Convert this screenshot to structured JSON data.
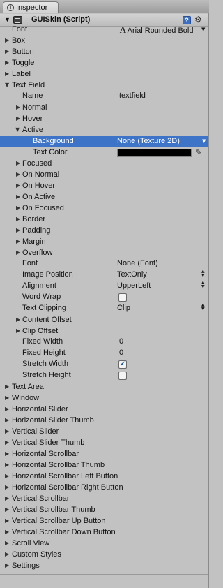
{
  "tab": {
    "label": "Inspector",
    "icon": "info-icon"
  },
  "component": {
    "title": "GUISkin (Script)",
    "help_glyph": "?",
    "gear_glyph": "⚙"
  },
  "font_field": {
    "label": "Font",
    "value": "Arial Rounded Bold"
  },
  "top_items": [
    "Box",
    "Button",
    "Toggle",
    "Label"
  ],
  "text_field": {
    "label": "Text Field",
    "name_label": "Name",
    "name_value": "textfield",
    "normal": "Normal",
    "hover": "Hover",
    "active": "Active",
    "background_label": "Background",
    "background_value": "None (Texture 2D)",
    "text_color_label": "Text Color",
    "text_color": "#000000",
    "focused": "Focused",
    "on_normal": "On Normal",
    "on_hover": "On Hover",
    "on_active": "On Active",
    "on_focused": "On Focused",
    "border": "Border",
    "padding": "Padding",
    "margin": "Margin",
    "overflow": "Overflow",
    "font_label": "Font",
    "font_value": "None (Font)",
    "image_position_label": "Image Position",
    "image_position_value": "TextOnly",
    "alignment_label": "Alignment",
    "alignment_value": "UpperLeft",
    "word_wrap_label": "Word Wrap",
    "word_wrap": false,
    "text_clipping_label": "Text Clipping",
    "text_clipping_value": "Clip",
    "content_offset": "Content Offset",
    "clip_offset": "Clip Offset",
    "fixed_width_label": "Fixed Width",
    "fixed_width_value": "0",
    "fixed_height_label": "Fixed Height",
    "fixed_height_value": "0",
    "stretch_width_label": "Stretch Width",
    "stretch_width": true,
    "stretch_height_label": "Stretch Height",
    "stretch_height": false
  },
  "bottom_items": [
    "Text Area",
    "Window",
    "Horizontal Slider",
    "Horizontal Slider Thumb",
    "Vertical Slider",
    "Vertical Slider Thumb",
    "Horizontal Scrollbar",
    "Horizontal Scrollbar Thumb",
    "Horizontal Scrollbar Left Button",
    "Horizontal Scrollbar Right Button",
    "Vertical Scrollbar",
    "Vertical Scrollbar Thumb",
    "Vertical Scrollbar Up Button",
    "Vertical Scrollbar Down Button",
    "Scroll View",
    "Custom Styles",
    "Settings"
  ],
  "colors": {
    "selection": "#3d74c8",
    "panel": "#c2c2c2"
  }
}
